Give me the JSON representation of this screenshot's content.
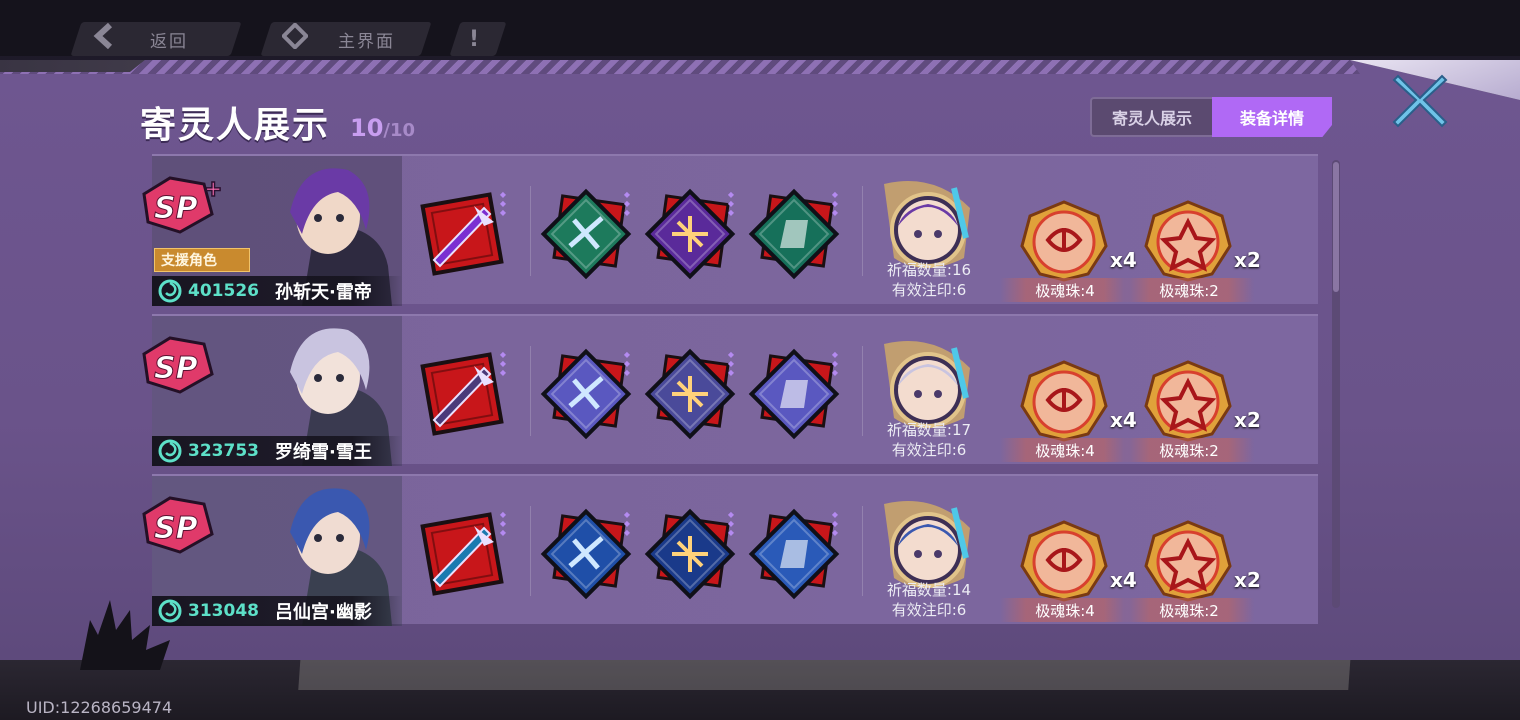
{
  "nav": {
    "back_label": "返回",
    "home_label": "主界面",
    "alert_symbol": "!"
  },
  "page": {
    "title": "寄灵人展示",
    "count_current": "10",
    "count_total": "/10",
    "uid": "UID:12268659474"
  },
  "tabs": [
    {
      "label": "寄灵人展示",
      "active": false
    },
    {
      "label": "装备详情",
      "active": true
    }
  ],
  "rows": [
    {
      "rank_badge": "SP+",
      "support_tag": "支援角色",
      "power": "401526",
      "name": "孙斩天·雷帝",
      "blessing_count": "祈福数量:16",
      "valid_seal": "有效注印:6",
      "orbs": [
        {
          "label": "极魂珠:4",
          "count": "x4"
        },
        {
          "label": "极魂珠:2",
          "count": "x2"
        }
      ],
      "palette": {
        "hair": "#6a3aa6",
        "skin": "#f0d8c8",
        "outfit": "#2e2a40",
        "weapon": "#7b2fd1",
        "skill1": "#1d7a5c",
        "skill2": "#5a2a9a",
        "skill3": "#16705a"
      }
    },
    {
      "rank_badge": "SP",
      "support_tag": "",
      "power": "323753",
      "name": "罗绮雪·雪王",
      "blessing_count": "祈福数量:17",
      "valid_seal": "有效注印:6",
      "orbs": [
        {
          "label": "极魂珠:4",
          "count": "x4"
        },
        {
          "label": "极魂珠:2",
          "count": "x2"
        }
      ],
      "palette": {
        "hair": "#c9c4e0",
        "skin": "#f2e2da",
        "outfit": "#3a3a50",
        "weapon": "#4a3a7a",
        "skill1": "#5a58c0",
        "skill2": "#4a4a9a",
        "skill3": "#5a58c0"
      }
    },
    {
      "rank_badge": "SP",
      "support_tag": "",
      "power": "313048",
      "name": "吕仙宫·幽影",
      "blessing_count": "祈福数量:14",
      "valid_seal": "有效注印:6",
      "orbs": [
        {
          "label": "极魂珠:4",
          "count": "x4"
        },
        {
          "label": "极魂珠:2",
          "count": "x2"
        }
      ],
      "palette": {
        "hair": "#3a58b0",
        "skin": "#f0dcd2",
        "outfit": "#3a4050",
        "weapon": "#1a7ab0",
        "skill1": "#1f4fa8",
        "skill2": "#1a3a8a",
        "skill3": "#2a5ab8"
      }
    }
  ],
  "colors": {
    "panel": "#6e5690",
    "accent_tab": "#b069f5",
    "power_text": "#5de0c8",
    "icon_frame_red": "#c8161a",
    "orb_gold": "#e0a13a",
    "orb_red": "#d8402e"
  },
  "icons": {
    "back": "chevron-left-icon",
    "home": "diamond-icon",
    "alert": "exclamation-icon",
    "close": "close-x-icon",
    "power": "spiral-icon"
  }
}
